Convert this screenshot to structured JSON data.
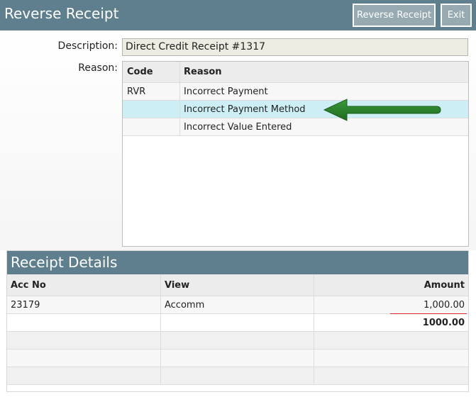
{
  "header": {
    "title": "Reverse Receipt",
    "reverse_button": "Reverse Receipt",
    "exit_button": "Exit"
  },
  "form": {
    "description_label": "Description:",
    "description_value": "Direct Credit Receipt #1317",
    "reason_label": "Reason:"
  },
  "reason_grid": {
    "columns": [
      "Code",
      "Reason"
    ],
    "rows": [
      {
        "code": "RVR",
        "reason": "Incorrect Payment"
      },
      {
        "code": "",
        "reason": "Incorrect Payment Method"
      },
      {
        "code": "",
        "reason": "Incorrect Value Entered"
      }
    ],
    "selected_row_color": "#cdeef5"
  },
  "receipt_details": {
    "title": "Receipt Details",
    "columns": [
      "Acc No",
      "View",
      "Amount"
    ],
    "rows": [
      {
        "acc_no": "23179",
        "view": "Accomm",
        "amount": "1,000.00"
      }
    ],
    "total": "1000.00"
  },
  "colors": {
    "header_bg": "#5f7f8e",
    "arrow": "#2b7a2b",
    "total_underline": "#d9232a"
  },
  "icons": {
    "annotation": "green-arrow-icon"
  }
}
